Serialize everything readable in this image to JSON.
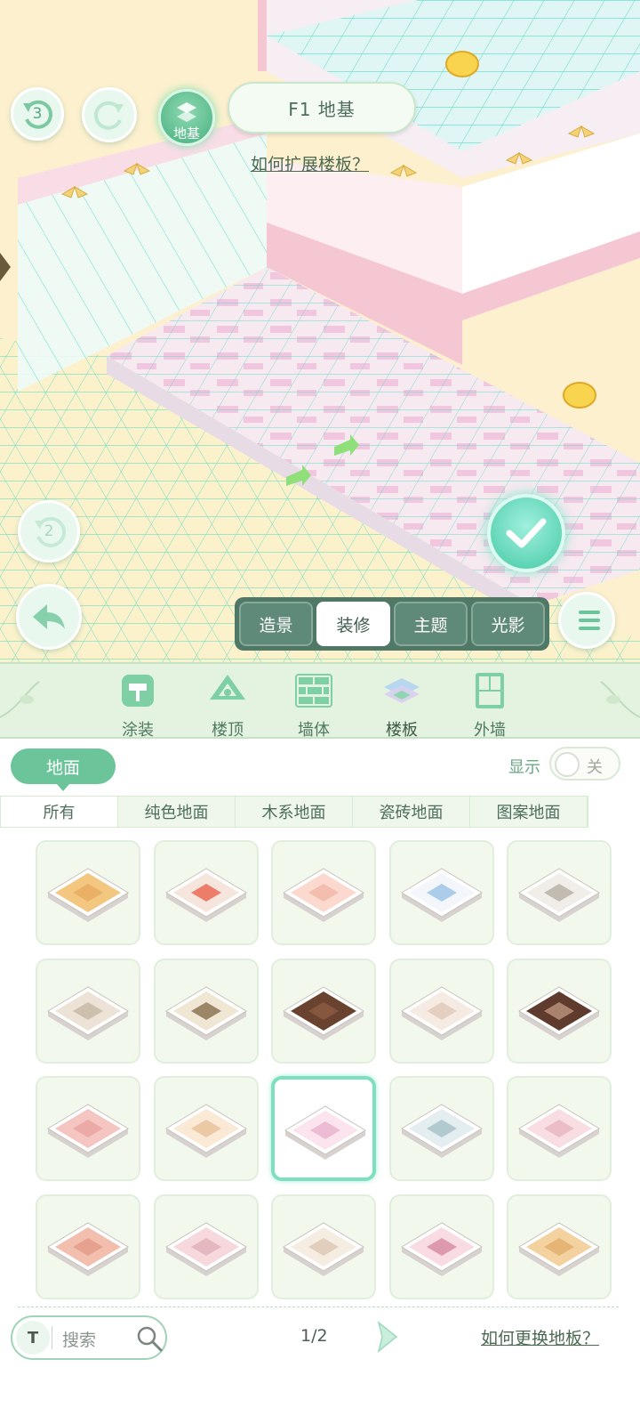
{
  "hud": {
    "undo_count": "3",
    "foundation_label": "地基",
    "floor_title": "F1 地基",
    "expand_link": "如何扩展楼板？",
    "secondary_count": "2"
  },
  "modes": [
    {
      "label": "造景",
      "active": false
    },
    {
      "label": "装修",
      "active": true
    },
    {
      "label": "主题",
      "active": false
    },
    {
      "label": "光影",
      "active": false
    }
  ],
  "categories": [
    {
      "label": "涂装",
      "icon": "paint-roller-icon"
    },
    {
      "label": "楼顶",
      "icon": "roof-icon"
    },
    {
      "label": "墙体",
      "icon": "brick-wall-icon"
    },
    {
      "label": "楼板",
      "icon": "floor-slab-icon",
      "active": true
    },
    {
      "label": "外墙",
      "icon": "exterior-wall-icon"
    }
  ],
  "panel": {
    "sub_tab": "地面",
    "show_label": "显示",
    "toggle_state": "关",
    "filters": [
      "所有",
      "纯色地面",
      "木系地面",
      "瓷砖地面",
      "图案地面"
    ],
    "selected_tile": 12
  },
  "tiles": [
    {
      "top": "#f3c77f",
      "accent": "#e7ad62"
    },
    {
      "top": "#f6e5dc",
      "accent": "#ea6b55"
    },
    {
      "top": "#fbd9cf",
      "accent": "#f2b9a8"
    },
    {
      "top": "#f3f6fb",
      "accent": "#9fc6e6"
    },
    {
      "top": "#f1eee9",
      "accent": "#b9b1a8"
    },
    {
      "top": "#ece3d6",
      "accent": "#c7b9a3"
    },
    {
      "top": "#efe7d4",
      "accent": "#8d7455"
    },
    {
      "top": "#6a4330",
      "accent": "#8b5a3e"
    },
    {
      "top": "#f6ebe2",
      "accent": "#e0cabb"
    },
    {
      "top": "#5e3b2c",
      "accent": "#b98f7a"
    },
    {
      "top": "#f5c5c2",
      "accent": "#e9a4a0"
    },
    {
      "top": "#fae9d5",
      "accent": "#e6c39b"
    },
    {
      "top": "#fbe4ee",
      "accent": "#e9b5cf"
    },
    {
      "top": "#e4eef0",
      "accent": "#a8c3c9"
    },
    {
      "top": "#f8dde2",
      "accent": "#e9b8c2"
    },
    {
      "top": "#f2bfae",
      "accent": "#e49c8a"
    },
    {
      "top": "#f6d8dd",
      "accent": "#e2b1ba"
    },
    {
      "top": "#f5ece2",
      "accent": "#ddc9b6"
    },
    {
      "top": "#f8dbe3",
      "accent": "#d98ea3"
    },
    {
      "top": "#f3d2a0",
      "accent": "#e3b06d"
    }
  ],
  "footer": {
    "search_placeholder": "搜索",
    "page": "1/2",
    "help_link": "如何更换地板？"
  },
  "colors": {
    "accent_green": "#6cc59a",
    "mode_bar": "#4f7867",
    "grid_line": "#56d8c6"
  }
}
